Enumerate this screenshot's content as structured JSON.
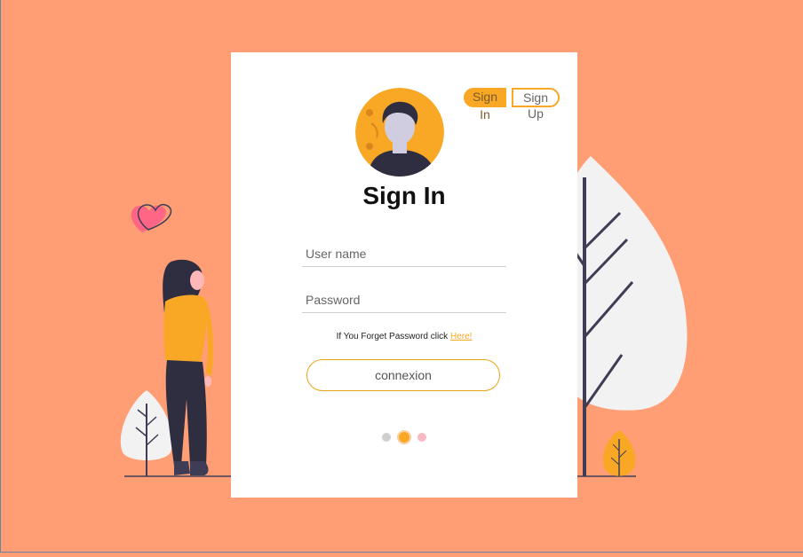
{
  "colors": {
    "background": "#FF9E74",
    "accent": "#F9A826",
    "card": "#FFFFFF"
  },
  "toggles": {
    "signin_label": "Sign In",
    "signup_label": "Sign Up"
  },
  "title": "Sign In",
  "form": {
    "username_placeholder": "User name",
    "password_placeholder": "Password",
    "username_value": "",
    "password_value": ""
  },
  "forgot": {
    "text": "If You Forget Password click ",
    "link_label": "Here!"
  },
  "submit_label": "connexion",
  "pager": {
    "count": 3,
    "active_index": 1
  },
  "icons": [
    "heart-icon",
    "avatar-illustration",
    "woman-illustration",
    "tree-illustration"
  ]
}
